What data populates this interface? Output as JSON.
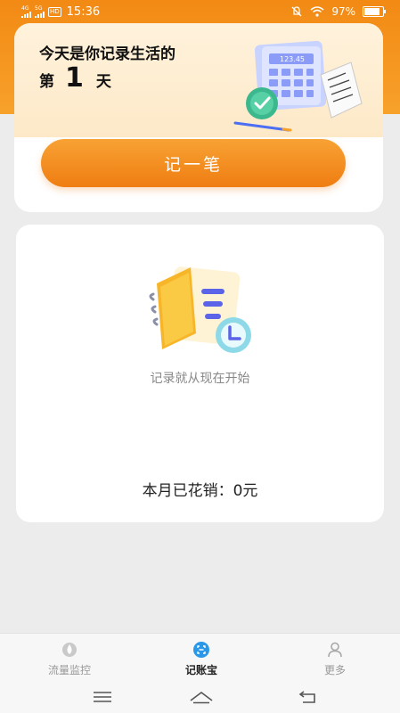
{
  "status_bar": {
    "sim1": "4G",
    "sim2": "5G",
    "hd": "HD",
    "time": "15:36",
    "battery": "97%",
    "icons": [
      "mute-icon",
      "wifi-icon",
      "battery-icon"
    ]
  },
  "header": {
    "line1": "今天是你记录生活的",
    "prefix": "第",
    "day_count": "1",
    "suffix": "天",
    "calculator_display": "123.45"
  },
  "record_button_label": "记一笔",
  "main": {
    "empty_text": "记录就从现在开始",
    "month_spend_label": "本月已花销：",
    "month_spend_value": "0元"
  },
  "tabs": [
    {
      "label": "流量监控",
      "icon": "traffic-icon",
      "active": false
    },
    {
      "label": "记账宝",
      "icon": "ledger-icon",
      "active": true
    },
    {
      "label": "更多",
      "icon": "user-icon",
      "active": false
    }
  ],
  "nav": [
    "menu-icon",
    "home-icon",
    "back-icon"
  ],
  "colors": {
    "accent": "#f28a14",
    "active_tab_icon": "#2a97e8",
    "background": "#ececec"
  }
}
